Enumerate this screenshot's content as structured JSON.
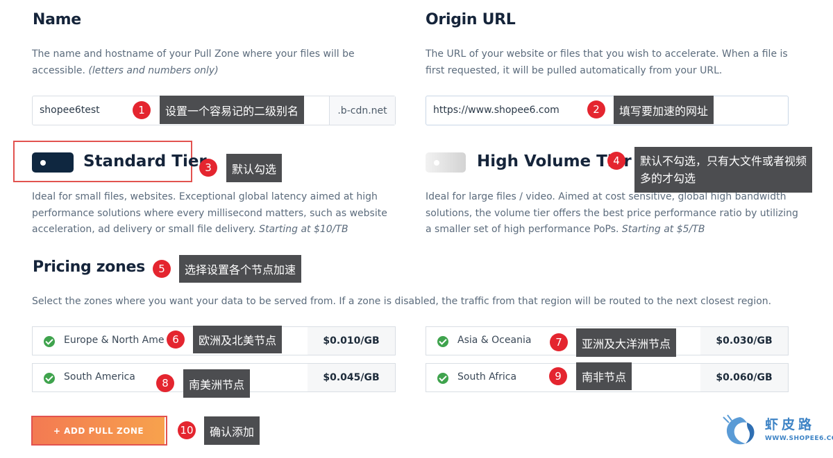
{
  "name_section": {
    "title": "Name",
    "desc_line1": "The name and hostname of your Pull Zone where your files will be",
    "desc_line2_a": "accessible. ",
    "desc_line2_b": "(letters and numbers only)",
    "input_value": "shopee6test",
    "suffix": ".b-cdn.net"
  },
  "origin_section": {
    "title": "Origin URL",
    "desc_line1": "The URL of your website or files that you wish to accelerate. When a file is",
    "desc_line2": "first requested, it will be pulled automatically from your URL.",
    "input_value": "https://www.shopee6.com"
  },
  "standard_tier": {
    "label": "Standard Tier",
    "enabled": true,
    "desc_line1": "Ideal for small files, websites. Exceptional global latency aimed at high",
    "desc_line2": "performance solutions where every millisecond matters, such as website",
    "desc_line3_a": "acceleration, ad delivery or small file delivery. ",
    "desc_line3_b": "Starting at $10/TB"
  },
  "high_volume_tier": {
    "label": "High Volume Tier",
    "enabled": false,
    "desc_line1": "Ideal for large files / video. Aimed at cost sensitive, global high bandwidth",
    "desc_line2": "solutions, the volume tier offers the best price performance ratio by utilizing",
    "desc_line3_a": "a smaller set of high performance PoPs. ",
    "desc_line3_b": "Starting at $5/TB"
  },
  "pricing": {
    "title": "Pricing zones",
    "desc": "Select the zones where you want your data to be served from. If a zone is disabled, the traffic from that region will be routed to the next closest region.",
    "zones": [
      {
        "name": "Europe & North Ame",
        "price": "$0.010/GB"
      },
      {
        "name": "Asia & Oceania",
        "price": "$0.030/GB"
      },
      {
        "name": "South America",
        "price": "$0.045/GB"
      },
      {
        "name": "South Africa",
        "price": "$0.060/GB"
      }
    ]
  },
  "add_button": "+ ADD PULL ZONE",
  "annotations": [
    {
      "num": "1",
      "text": "设置一个容易记的二级别名"
    },
    {
      "num": "2",
      "text": "填写要加速的网址"
    },
    {
      "num": "3",
      "text": "默认勾选"
    },
    {
      "num": "4",
      "line1": "默认不勾选，只有大文件或者视频",
      "line2": "多的才勾选"
    },
    {
      "num": "5",
      "text": "选择设置各个节点加速"
    },
    {
      "num": "6",
      "text": "欧洲及北美节点"
    },
    {
      "num": "7",
      "text": "亚洲及大洋洲节点"
    },
    {
      "num": "8",
      "text": "南美洲节点"
    },
    {
      "num": "9",
      "text": "南非节点"
    },
    {
      "num": "10",
      "text": "确认添加"
    }
  ],
  "watermark": {
    "cn": "虾皮路",
    "url": "WWW.SHOPEE6.COM"
  },
  "colors": {
    "badge": "#e4252f",
    "tooltip": "#4c4d50",
    "toggle_on": "#0f2740",
    "check": "#3fa34d",
    "button": "#f37a52"
  }
}
